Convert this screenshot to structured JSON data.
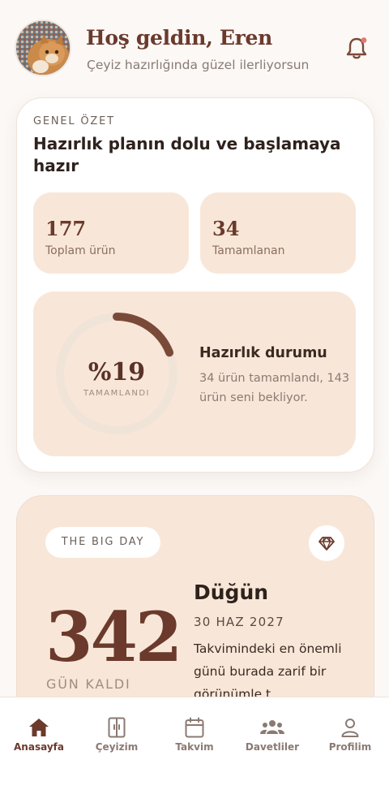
{
  "header": {
    "greeting": "Hoş geldin, Eren",
    "subtitle": "Çeyiz hazırlığında güzel ilerliyorsun",
    "avatar_icon": "cat-photo",
    "bell_icon": "bell-icon",
    "has_notification": true
  },
  "summary": {
    "eyebrow": "GENEL ÖZET",
    "title": "Hazırlık planın dolu ve başlamaya hazır",
    "stats": [
      {
        "value": "177",
        "label": "Toplam ürün"
      },
      {
        "value": "34",
        "label": "Tamamlanan"
      }
    ],
    "progress": {
      "percent_text": "%19",
      "percent_value": 19,
      "caption": "TAMAMLANDI",
      "title": "Hazırlık durumu",
      "description": "34 ürün tamamlandı, 143 ürün seni bekliyor."
    }
  },
  "event": {
    "tag": "THE BIG DAY",
    "gem_icon": "diamond-icon",
    "days": "342",
    "days_label": "GÜN KALDI",
    "title": "Düğün",
    "date": "30 HAZ 2027",
    "description": "Takvimindeki en önemli günü burada zarif bir görünümle t..."
  },
  "nav": {
    "items": [
      {
        "label": "Anasayfa",
        "icon": "home-icon",
        "active": true
      },
      {
        "label": "Çeyizim",
        "icon": "wardrobe-icon",
        "active": false
      },
      {
        "label": "Takvim",
        "icon": "calendar-icon",
        "active": false
      },
      {
        "label": "Davetliler",
        "icon": "guests-icon",
        "active": false
      },
      {
        "label": "Profilim",
        "icon": "profile-icon",
        "active": false
      }
    ]
  },
  "colors": {
    "accent": "#6b3a2c",
    "progress_arc": "#7a4a38",
    "card_beige": "#f8e7d8",
    "notification_dot": "#e07a6e"
  }
}
